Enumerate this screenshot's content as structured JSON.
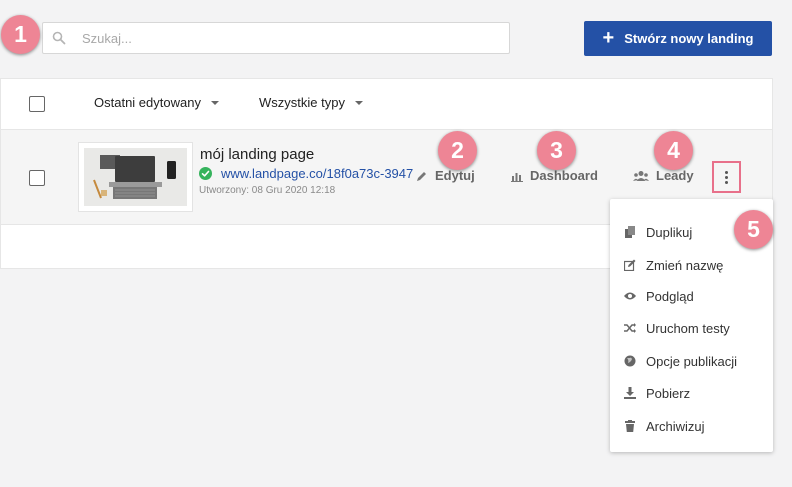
{
  "search": {
    "placeholder": "Szukaj...",
    "value": ""
  },
  "create_button": {
    "label": "Stwórz nowy landing"
  },
  "filters": {
    "sort_label": "Ostatni edytowany",
    "type_label": "Wszystkie typy"
  },
  "landing": {
    "name": "mój landing page",
    "url": "www.landpage.co/18f0a73c-3947",
    "created": "Utworzony: 08 Gru 2020 12:18",
    "status": "published"
  },
  "actions": {
    "edit": "Edytuj",
    "dashboard": "Dashboard",
    "leads": "Leady"
  },
  "menu_items": [
    {
      "label": "Duplikuj",
      "icon": "copy-icon"
    },
    {
      "label": "Zmień nazwę",
      "icon": "edit-square-icon"
    },
    {
      "label": "Podgląd",
      "icon": "eye-icon"
    },
    {
      "label": "Uruchom testy",
      "icon": "shuffle-icon"
    },
    {
      "label": "Opcje publikacji",
      "icon": "globe-icon"
    },
    {
      "label": "Pobierz",
      "icon": "download-icon"
    },
    {
      "label": "Archiwizuj",
      "icon": "trash-icon"
    }
  ],
  "annotations": [
    "1",
    "2",
    "3",
    "4",
    "5"
  ],
  "colors": {
    "primary": "#2451a6",
    "badge": "#ee8595",
    "success": "#35b35c",
    "highlight": "#e8708a"
  }
}
